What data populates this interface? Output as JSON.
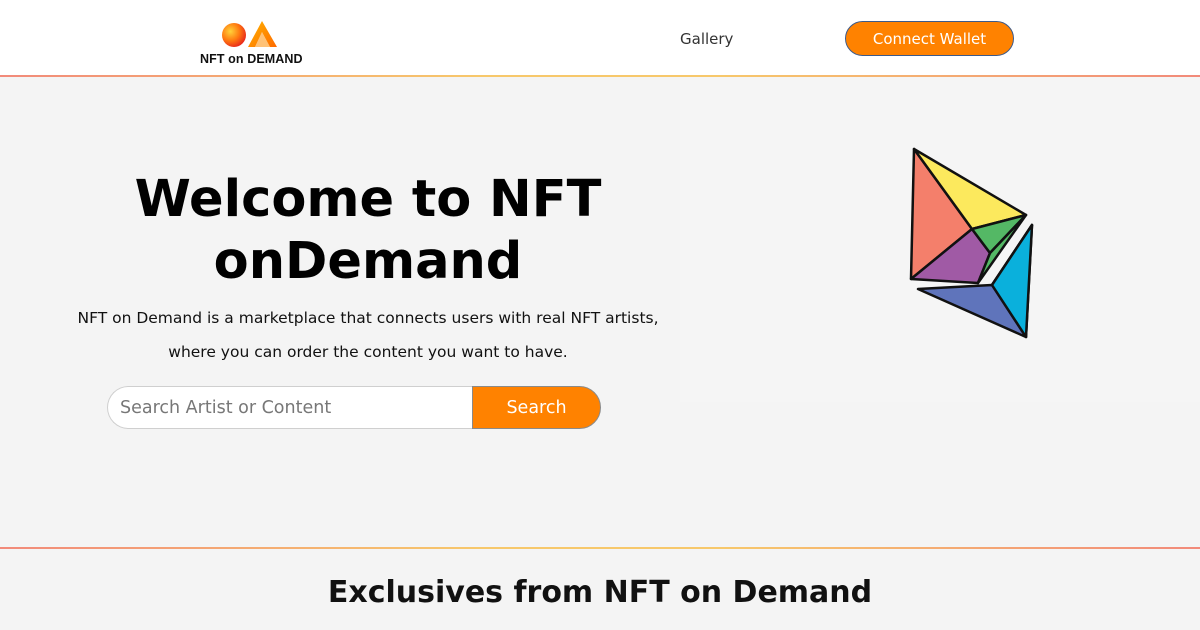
{
  "header": {
    "logo_text": "NFT on DEMAND",
    "nav": {
      "gallery_label": "Gallery"
    },
    "connect_wallet_label": "Connect Wallet"
  },
  "hero": {
    "title": "Welcome to NFT onDemand",
    "description": "NFT on Demand is a marketplace that connects users with real NFT artists, where you can order the content you want to have.",
    "search": {
      "placeholder": "Search Artist or Content",
      "value": "",
      "button_label": "Search"
    },
    "illustration_icon": "ethereum-logo-icon"
  },
  "exclusives": {
    "title": "Exclusives from NFT on Demand"
  },
  "colors": {
    "accent": "#ff8200",
    "background": "#f4f4f4",
    "header_background": "#ffffff"
  }
}
